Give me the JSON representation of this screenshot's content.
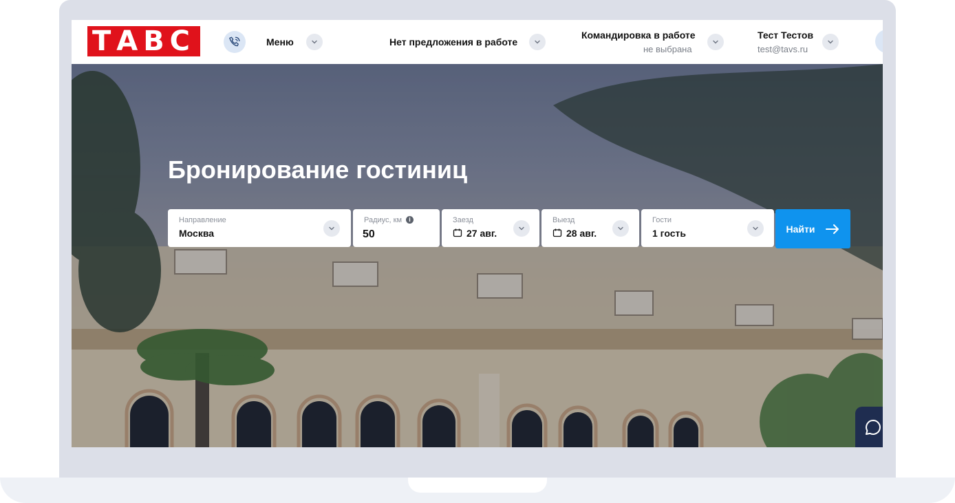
{
  "header": {
    "logo_text": "ТАВС",
    "menu_label": "Меню",
    "offer_status": "Нет предложения в работе",
    "trip_title": "Командировка в работе",
    "trip_subtitle": "не выбрана",
    "user_name": "Тест Тестов",
    "user_email": "test@tavs.ru"
  },
  "hero": {
    "title": "Бронирование гостиниц"
  },
  "search": {
    "direction_label": "Направление",
    "direction_value": "Москва",
    "radius_label": "Радиус, км",
    "radius_info": "i",
    "radius_value": "50",
    "checkin_label": "Заезд",
    "checkin_value": "27 авг.",
    "checkout_label": "Выезд",
    "checkout_value": "28 авг.",
    "guests_label": "Гости",
    "guests_value": "1 гость",
    "submit_label": "Найти"
  },
  "colors": {
    "brand_red": "#e0121b",
    "accent_blue": "#0f93ee",
    "chat_navy": "#1f2d50"
  },
  "icons": {
    "phone": "phone-icon",
    "chevron": "chevron-down-icon",
    "calendar": "calendar-icon",
    "arrow": "arrow-right-icon",
    "chat": "chat-icon",
    "info": "info-icon"
  }
}
